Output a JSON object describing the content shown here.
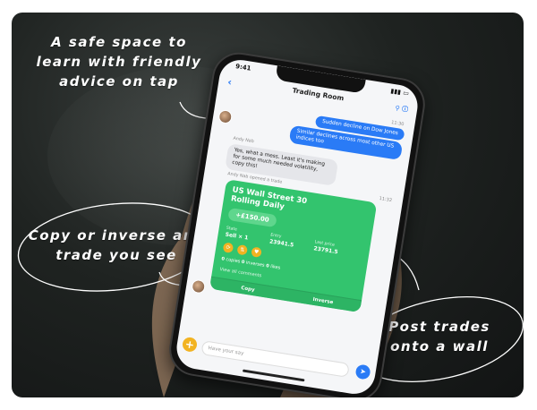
{
  "captions": {
    "top": [
      "A safe space to",
      "learn with friendly",
      "advice on tap"
    ],
    "left": [
      "Copy or inverse any",
      "trade you see"
    ],
    "right": [
      "Post trades",
      "onto a wall"
    ]
  },
  "phone": {
    "status_time": "9:41",
    "nav_title": "Trading Room",
    "back_glyph": "‹",
    "messages": {
      "time1": "11:30",
      "blue1": "Sudden decline on Dow Jones",
      "blue2": "Similar declines across most other US indices too",
      "sender": "Andy Nab",
      "grey1": "Yes, what a mess. Least it's making for some much needed volatility, copy this!",
      "opened": "Andy Nab opened a trade",
      "time2": "11:32"
    },
    "card": {
      "title": "US Wall Street 30 Rolling Daily",
      "pnl": "+£150.00",
      "state_label": "State",
      "state_value": "Sell × 1",
      "entry_label": "Entry",
      "entry_value": "23941.5",
      "last_label": "Last price",
      "last_value": "23791.5",
      "copies": "0",
      "copies_label": "copies",
      "inverses": "0",
      "inverses_label": "inverses",
      "likes": "0",
      "likes_label": "likes",
      "view_comments": "View all comments",
      "copy_btn": "Copy",
      "inverse_btn": "Inverse"
    },
    "composer_placeholder": "Have your say"
  },
  "colors": {
    "accent_blue": "#2a7bf6",
    "card_green": "#33c46e",
    "yellow": "#f2b322"
  }
}
